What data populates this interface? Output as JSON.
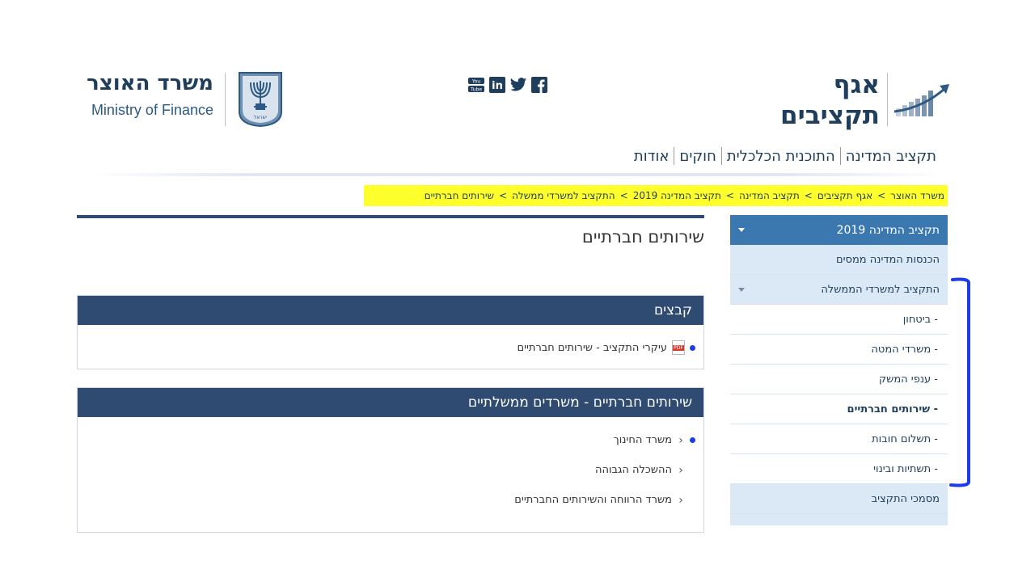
{
  "header": {
    "dept_name_line1": "אגף",
    "dept_name_line2": "תקציבים",
    "ministry_he": "משרד האוצר",
    "ministry_en": "Ministry of Finance",
    "emblem_text": "ישראל",
    "social": [
      {
        "icon": "facebook-icon",
        "label": "f"
      },
      {
        "icon": "twitter-icon",
        "label": ""
      },
      {
        "icon": "linkedin-icon",
        "label": "in"
      },
      {
        "icon": "youtube-icon",
        "label": "You Tube"
      }
    ]
  },
  "topnav": {
    "items": [
      "תקציב המדינה",
      "התוכנית הכלכלית",
      "חוקים",
      "אודות"
    ]
  },
  "breadcrumb": {
    "items": [
      "משרד האוצר",
      "אגף תקציבים",
      "תקציב המדינה",
      "תקציב המדינה 2019",
      "התקציב למשרדי ממשלה",
      "שירותים חברתיים"
    ],
    "separator": ">"
  },
  "sidebar": {
    "header": "תקציב המדינה 2019",
    "items": [
      {
        "label": "הכנסות המדינה ממסים"
      },
      {
        "label": "התקציב למשרדי הממשלה"
      },
      {
        "label": "- ביטחון"
      },
      {
        "label": "- משרדי המטה"
      },
      {
        "label": "- ענפי המשק"
      },
      {
        "label": "- שירותים חברתיים"
      },
      {
        "label": "- תשלום חובות"
      },
      {
        "label": "- תשתיות ובינוי"
      },
      {
        "label": "מסמכי התקציב"
      }
    ]
  },
  "main": {
    "title": "שירותים חברתיים",
    "files_panel": {
      "heading": "קבצים",
      "file_label": "עיקרי התקציב - שירותים חברתיים",
      "file_icon_text": "PDF"
    },
    "ministries_panel": {
      "heading": "שירותים חברתיים - משרדים ממשלתיים",
      "items": [
        "משרד החינוך",
        "ההשכלה הגבוהה",
        "משרד הרווחה והשירותים החברתיים"
      ]
    }
  },
  "colors": {
    "navy": "#2f4b72",
    "sidebar_active": "#3b78b0",
    "sidebar_light": "#dbe9f7",
    "highlight": "#ffff2b",
    "annotation": "#1d3ce6"
  }
}
